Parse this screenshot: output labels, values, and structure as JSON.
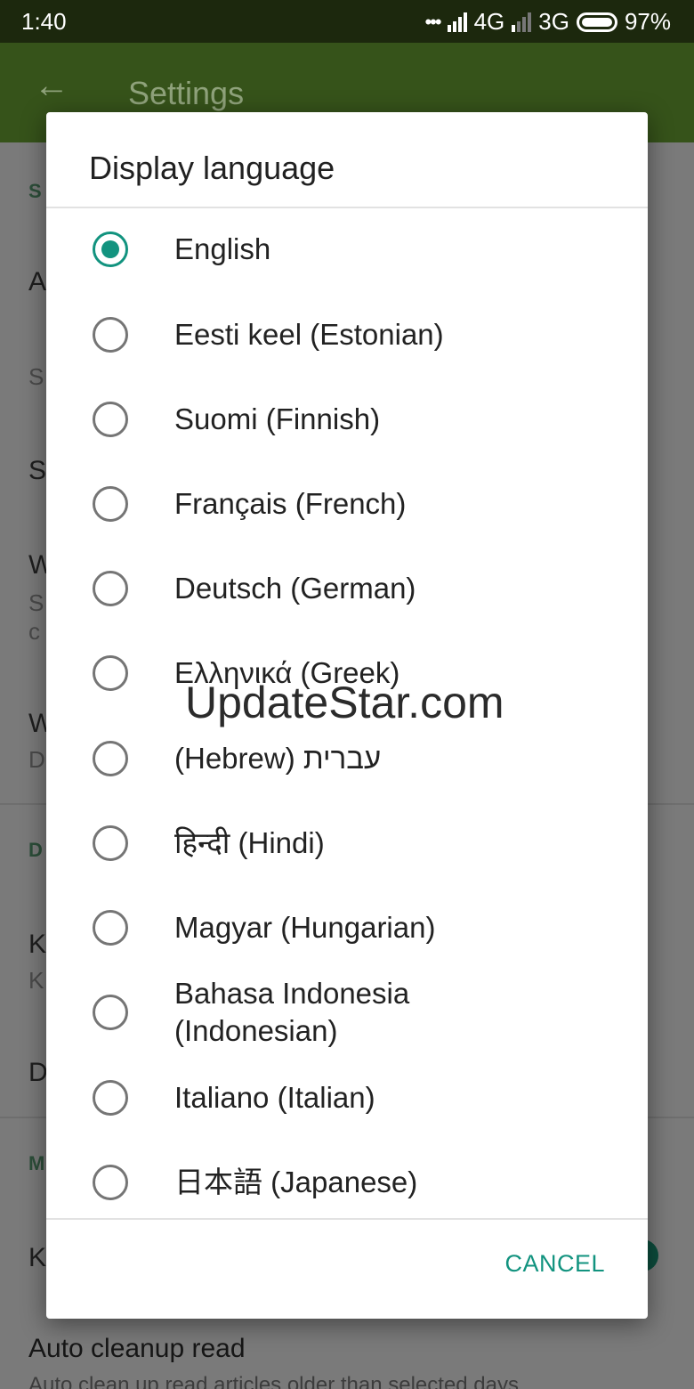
{
  "status_bar": {
    "time": "1:40",
    "network_primary": "4G",
    "network_secondary": "3G",
    "battery": "97%"
  },
  "app_bar": {
    "title": "Settings",
    "back_icon": "arrow-back-icon"
  },
  "background": {
    "auto_cleanup_title": "Auto cleanup read",
    "auto_cleanup_desc": "Auto clean up read articles older than selected days"
  },
  "dialog": {
    "title": "Display language",
    "options": [
      {
        "label": "English",
        "selected": true
      },
      {
        "label": "Eesti keel (Estonian)",
        "selected": false
      },
      {
        "label": "Suomi (Finnish)",
        "selected": false
      },
      {
        "label": "Français (French)",
        "selected": false
      },
      {
        "label": "Deutsch (German)",
        "selected": false
      },
      {
        "label": "Ελληνικά (Greek)",
        "selected": false
      },
      {
        "label": "(Hebrew) עברית",
        "selected": false
      },
      {
        "label": "हिन्दी (Hindi)",
        "selected": false
      },
      {
        "label": "Magyar (Hungarian)",
        "selected": false
      },
      {
        "label": "Bahasa Indonesia (Indonesian)",
        "selected": false
      },
      {
        "label": "Italiano (Italian)",
        "selected": false
      },
      {
        "label": "日本語 (Japanese)",
        "selected": false
      }
    ],
    "cancel_label": "CANCEL"
  },
  "watermark": "UpdateStar.com",
  "colors": {
    "accent": "#12937f",
    "app_bar": "#36531a",
    "status_bar": "#1c280d"
  }
}
